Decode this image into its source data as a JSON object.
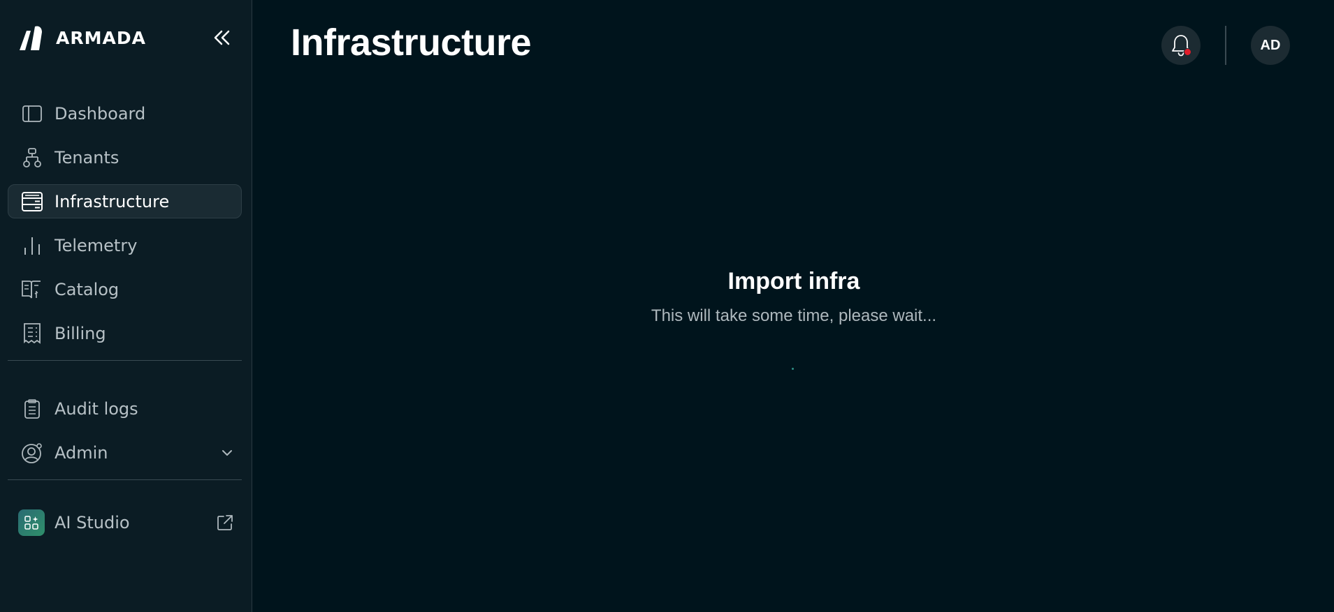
{
  "brand": {
    "name": "ARMADA"
  },
  "sidebar": {
    "collapse_icon": "double-chevron-left-icon",
    "items": [
      {
        "label": "Dashboard",
        "icon": "panel-layout-icon",
        "active": false
      },
      {
        "label": "Tenants",
        "icon": "hierarchy-icon",
        "active": false
      },
      {
        "label": "Infrastructure",
        "icon": "server-icon",
        "active": true
      },
      {
        "label": "Telemetry",
        "icon": "bar-chart-icon",
        "active": false
      },
      {
        "label": "Catalog",
        "icon": "book-icon",
        "active": false
      },
      {
        "label": "Billing",
        "icon": "receipt-icon",
        "active": false
      }
    ],
    "secondary_items": [
      {
        "label": "Audit logs",
        "icon": "clipboard-icon"
      },
      {
        "label": "Admin",
        "icon": "user-gear-icon",
        "has_dropdown": true
      }
    ],
    "external_items": [
      {
        "label": "AI Studio",
        "icon": "ai-studio-icon",
        "external": true
      }
    ]
  },
  "header": {
    "title": "Infrastructure",
    "notifications_icon": "bell-icon",
    "has_unread": true,
    "avatar_initials": "AD"
  },
  "main": {
    "loading_title": "Import infra",
    "loading_message": "This will take some time, please wait..."
  },
  "colors": {
    "background": "#00141c",
    "sidebar": "#0b1c24",
    "active_item": "#1a2b33",
    "notification_dot": "#e11d2a"
  }
}
